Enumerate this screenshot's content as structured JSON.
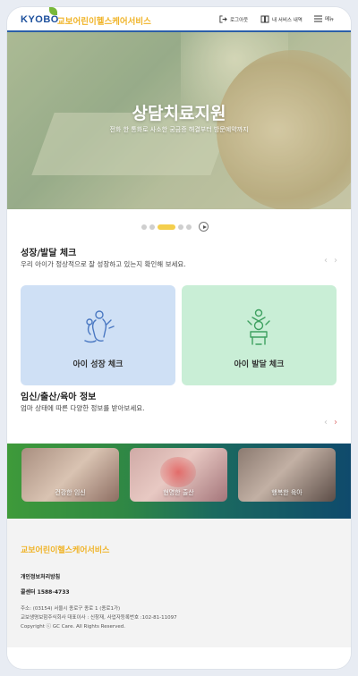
{
  "header": {
    "logo_main": "KYOBO",
    "logo_sub": "교보어린이헬스케어서비스",
    "logout_label": "로그아웃",
    "my_service_label": "내 서비스 내역",
    "menu_label": "메뉴",
    "accent_color": "#2b5ea8"
  },
  "hero": {
    "title": "상담치료지원",
    "subtitle": "전화 한 통화로 사소한 궁금증 해결부터 방문예약까지"
  },
  "slider": {
    "dot_count": 5,
    "active_index": 2
  },
  "growth": {
    "title": "성장/발달 체크",
    "description": "우리 아이가 정상적으로 잘 성장하고 있는지 확인해 보세요.",
    "cards": [
      {
        "label": "아이 성장 체크",
        "icon": "child-growth-icon",
        "color": "#cfe0f5"
      },
      {
        "label": "아이 발달 체크",
        "icon": "child-development-icon",
        "color": "#c9eed6"
      }
    ]
  },
  "pregnancy": {
    "title": "임신/출산/육아 정보",
    "description": "엄마 상태에 따른 다양한 정보를 받아보세요.",
    "cards": [
      {
        "label": "건강한 임신"
      },
      {
        "label": "현명한 출산"
      },
      {
        "label": "행복한 육아"
      }
    ]
  },
  "footer": {
    "brand": "교보어린이헬스케어서비스",
    "privacy_link": "개인정보처리방침",
    "call_center": "콜센터 1588-4733",
    "address": "주소: (03154) 서울시 종로구 종로 1 (종로1가)",
    "company": "교보생명보험주식회사 대표이사 : 신창재, 사업자등록번호 :102-81-11097",
    "copyright": "Copyright ⓒ GC Care. All Rights Reserved."
  },
  "nav_arrows": {
    "prev": "‹",
    "next": "›"
  }
}
